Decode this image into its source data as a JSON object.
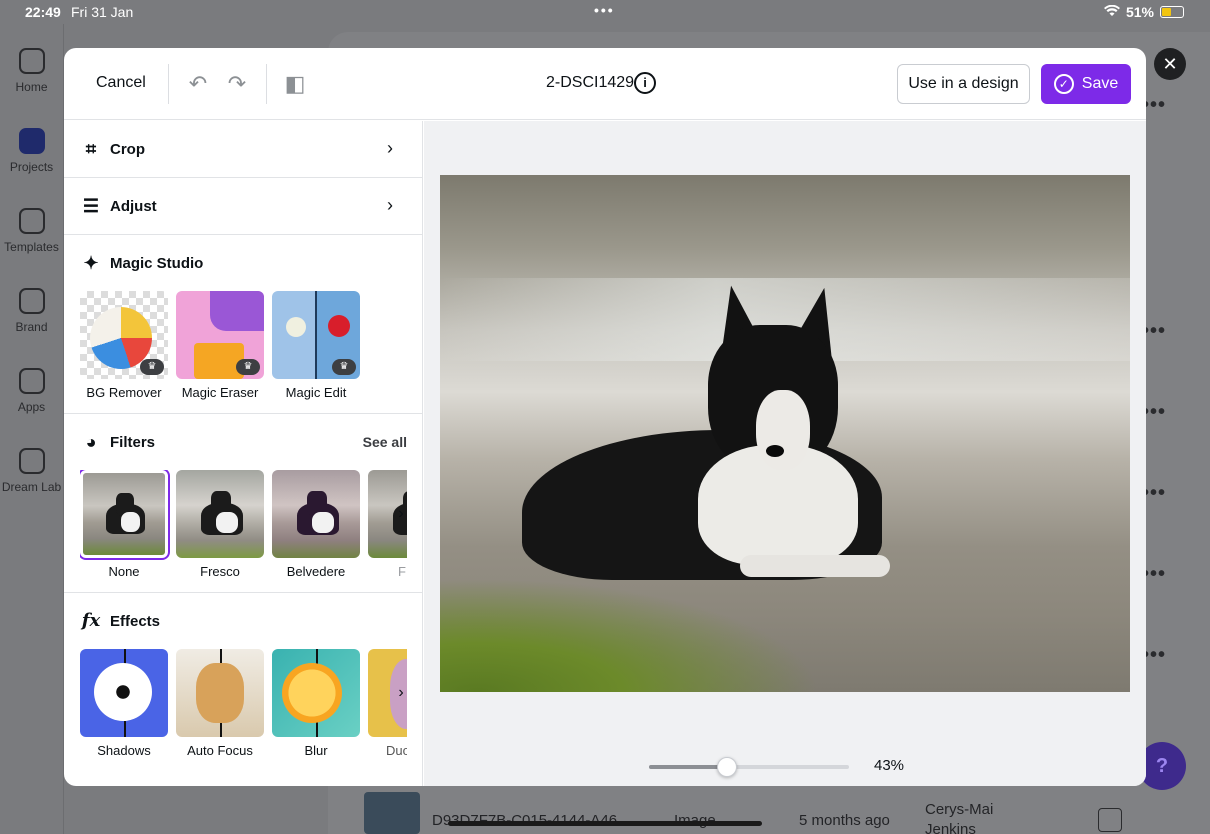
{
  "status_bar": {
    "time": "22:49",
    "date": "Fri 31 Jan",
    "battery": "51%",
    "battery_level": 0.51
  },
  "background_sidebar": [
    {
      "label": "Home",
      "icon": "home-icon"
    },
    {
      "label": "Projects",
      "icon": "folder-icon",
      "active": true
    },
    {
      "label": "Templates",
      "icon": "templates-icon"
    },
    {
      "label": "Brand",
      "icon": "brand-icon"
    },
    {
      "label": "Apps",
      "icon": "apps-icon"
    },
    {
      "label": "Dream Lab",
      "icon": "dream-lab-icon"
    }
  ],
  "background_row": {
    "name": "D93D7F7B-C015-4144-A46",
    "type": "Image",
    "edited": "5 months ago",
    "owner": "Cerys-Mai Jenkins"
  },
  "help_label": "?",
  "editor": {
    "cancel_label": "Cancel",
    "file_title": "2-DSCI1429",
    "use_in_design_label": "Use in a design",
    "save_label": "Save",
    "sections": {
      "crop": "Crop",
      "adjust": "Adjust",
      "magic_studio": "Magic Studio",
      "filters": "Filters",
      "filters_see_all": "See all",
      "effects": "Effects"
    },
    "magic_tools": [
      "BG Remover",
      "Magic Eraser",
      "Magic Edit"
    ],
    "filters": [
      "None",
      "Fresco",
      "Belvedere",
      "F"
    ],
    "effects": [
      "Shadows",
      "Auto Focus",
      "Blur",
      "Duo"
    ],
    "zoom": {
      "value": 43,
      "label": "43%",
      "slider_fraction": 0.39
    }
  }
}
